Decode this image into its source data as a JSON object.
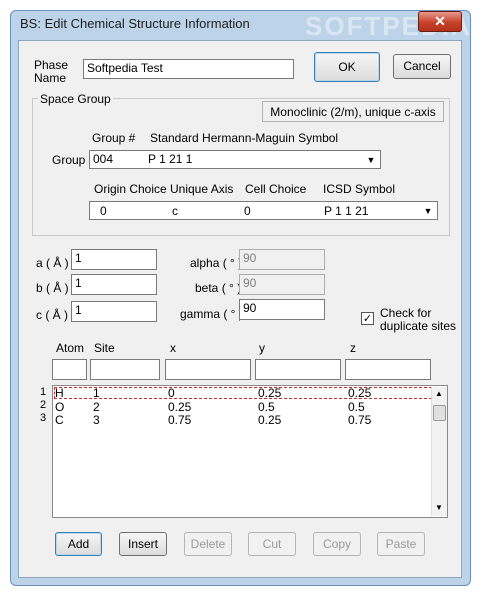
{
  "window": {
    "title": "BS: Edit Chemical Structure Information",
    "watermark": "SOFTPEDIA",
    "close_glyph": "✕"
  },
  "phase": {
    "label_line1": "Phase",
    "label_line2": "Name",
    "value": "Softpedia Test"
  },
  "buttons": {
    "ok": "OK",
    "cancel": "Cancel"
  },
  "space_group": {
    "legend": "Space Group",
    "crystal_system": "Monoclinic (2/m), unique c-axis",
    "group_label": "Group :",
    "group_num_header": "Group #",
    "symbol_header": "Standard Hermann-Maguin Symbol",
    "group_num": "004",
    "symbol": "P 1 21 1",
    "origin_header": "Origin Choice",
    "axis_header": "Unique Axis",
    "cell_header": "Cell Choice",
    "icsd_header": "ICSD Symbol",
    "origin": "0",
    "axis": "c",
    "cell": "0",
    "icsd": "P 1 1 21"
  },
  "lattice": {
    "a_label": "a ( Å )",
    "a": "1",
    "b_label": "b ( Å )",
    "b": "1",
    "c_label": "c ( Å )",
    "c": "1",
    "alpha_label": "alpha ( ° )",
    "alpha": "90",
    "beta_label": "beta ( ° )",
    "beta": "90",
    "gamma_label": "gamma ( ° )",
    "gamma": "90"
  },
  "duplicate": {
    "checked": true,
    "check_glyph": "✓",
    "line1": "Check for",
    "line2": "duplicate sites"
  },
  "atoms": {
    "headers": {
      "atom": "Atom",
      "site": "Site",
      "x": "x",
      "y": "y",
      "z": "z"
    },
    "rows": [
      {
        "num": "1",
        "atom": "H",
        "site": "1",
        "x": "0",
        "y": "0.25",
        "z": "0.25"
      },
      {
        "num": "2",
        "atom": "O",
        "site": "2",
        "x": "0.25",
        "y": "0.5",
        "z": "0.5"
      },
      {
        "num": "3",
        "atom": "C",
        "site": "3",
        "x": "0.75",
        "y": "0.25",
        "z": "0.75"
      }
    ]
  },
  "actions": {
    "add": "Add",
    "insert": "Insert",
    "delete": "Delete",
    "cut": "Cut",
    "copy": "Copy",
    "paste": "Paste"
  }
}
